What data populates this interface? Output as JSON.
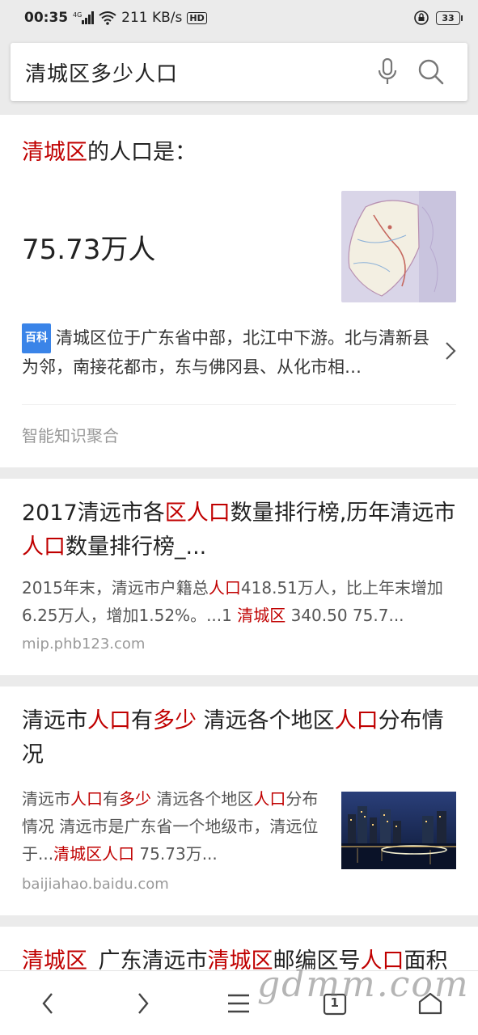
{
  "status_bar": {
    "time": "00:35",
    "network": "4G",
    "speed": "211 KB/s",
    "hd": "HD",
    "battery": "33"
  },
  "search": {
    "query": "清城区多少人口",
    "mic_icon": "microphone-icon",
    "search_icon": "search-icon"
  },
  "answer_card": {
    "title_hl": "清城区",
    "title_rest": "的人口是：",
    "value": "75.73万人",
    "tag": "百科",
    "summary": "清城区位于广东省中部，北江中下游。北与清新县为邻，南接花都市，东与佛冈县、从化市相…",
    "source_note": "智能知识聚合"
  },
  "results": [
    {
      "title": [
        {
          "t": "2017清远市各",
          "hl": false
        },
        {
          "t": "区人口",
          "hl": true
        },
        {
          "t": "数量排行榜,历年清远市",
          "hl": false
        },
        {
          "t": "人口",
          "hl": true
        },
        {
          "t": "数量排行榜_...",
          "hl": false
        }
      ],
      "snippet": [
        {
          "t": "2015年末，清远市户籍总",
          "hl": false
        },
        {
          "t": "人口",
          "hl": true
        },
        {
          "t": "418.51万人，比上年末增加6.25万人，增加1.52%。...1 ",
          "hl": false
        },
        {
          "t": "清城区",
          "hl": true
        },
        {
          "t": " 340.50 75.7...",
          "hl": false
        }
      ],
      "url": "mip.phb123.com"
    },
    {
      "title": [
        {
          "t": "清远市",
          "hl": false
        },
        {
          "t": "人口",
          "hl": true
        },
        {
          "t": "有",
          "hl": false
        },
        {
          "t": "多少",
          "hl": true
        },
        {
          "t": " 清远各个地区",
          "hl": false
        },
        {
          "t": "人口",
          "hl": true
        },
        {
          "t": "分布情况",
          "hl": false
        }
      ],
      "snippet": [
        {
          "t": "清远市",
          "hl": false
        },
        {
          "t": "人口",
          "hl": true
        },
        {
          "t": "有",
          "hl": false
        },
        {
          "t": "多少",
          "hl": true
        },
        {
          "t": " 清远各个地区",
          "hl": false
        },
        {
          "t": "人口",
          "hl": true
        },
        {
          "t": "分布情况 清远市是广东省一个地级市，清远位于...",
          "hl": false
        },
        {
          "t": "清城区人口",
          "hl": true
        },
        {
          "t": " 75.73万...",
          "hl": false
        }
      ],
      "url": "baijiahao.baidu.com"
    },
    {
      "title": [
        {
          "t": "清城区",
          "hl": true
        },
        {
          "t": "_广东清远市",
          "hl": false
        },
        {
          "t": "清城区",
          "hl": true
        },
        {
          "t": "邮编区号",
          "hl": false
        },
        {
          "t": "人口",
          "hl": true
        },
        {
          "t": "面积查询",
          "hl": false
        }
      ]
    }
  ],
  "bottom_nav": {
    "tabs_count": "1",
    "watermark": "gdmm.com"
  },
  "colors": {
    "highlight": "#c00000",
    "baike_tag": "#3a84e8"
  }
}
